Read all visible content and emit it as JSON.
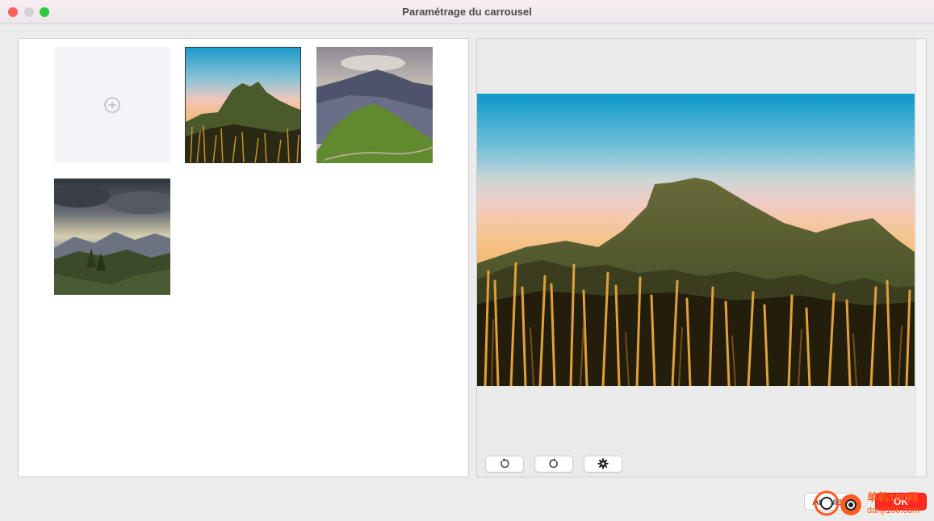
{
  "window": {
    "title": "Paramétrage du carrousel"
  },
  "gallery": {
    "add_icon": "plus-circle-icon",
    "images": [
      {
        "name": "mountain-sunset-grass",
        "selected": true
      },
      {
        "name": "misty-mountain-ridge",
        "selected": false
      },
      {
        "name": "cloudy-valley-sunrays",
        "selected": false
      }
    ]
  },
  "preview": {
    "image": "mountain-sunset-grass"
  },
  "toolbar": {
    "rotate_left_icon": "rotate-left-icon",
    "rotate_right_icon": "rotate-right-icon",
    "settings_icon": "gear-icon"
  },
  "footer": {
    "cancel_label": "Annuler",
    "ok_label": "OK"
  },
  "watermark": {
    "text": "单机100网",
    "url": "danji100.com"
  },
  "colors": {
    "ok_button": "#ff2a1f",
    "close": "#fe5f57",
    "maximize": "#2bc840"
  }
}
